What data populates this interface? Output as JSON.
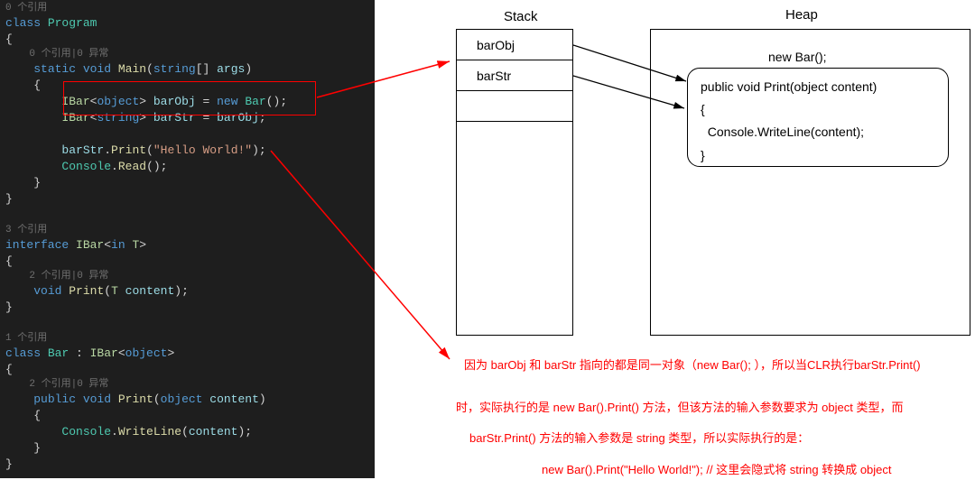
{
  "code": {
    "ref0": "0 个引用",
    "classProgram_class": "class ",
    "classProgram_name": "Program",
    "brace_open": "{",
    "brace_close": "}",
    "ref1": "0 个引用|0 异常",
    "mainSig_pre": "static void ",
    "mainSig_name": "Main",
    "mainSig_paren_open": "(",
    "mainSig_param_type": "string",
    "mainSig_param_brackets": "[] ",
    "mainSig_param_name": "args",
    "mainSig_paren_close": ")",
    "l1_iface": "IBar",
    "l1_lt": "<",
    "l1_typearg": "object",
    "l1_gt": "> ",
    "l1_var": "barObj",
    "l1_eq": " = ",
    "l1_new": "new ",
    "l1_ctor": "Bar",
    "l1_parens": "();",
    "l2_iface": "IBar",
    "l2_lt": "<",
    "l2_typearg": "string",
    "l2_gt": "> ",
    "l2_var": "barStr",
    "l2_eq": " = ",
    "l2_rhs": "barObj",
    "l2_semi": ";",
    "l3_var": "barStr",
    "l3_dot": ".",
    "l3_method": "Print",
    "l3_paren_open": "(",
    "l3_string": "\"Hello World!\"",
    "l3_paren_close": ");",
    "l4_class": "Console",
    "l4_dot": ".",
    "l4_method": "Read",
    "l4_parens": "();",
    "ref3": "3 个引用",
    "ifaceDecl_kw": "interface ",
    "ifaceDecl_name": "IBar",
    "ifaceDecl_lt": "<",
    "ifaceDecl_in": "in ",
    "ifaceDecl_T": "T",
    "ifaceDecl_gt": ">",
    "ref2": "2 个引用|0 异常",
    "ifaceMethod_void": "void ",
    "ifaceMethod_name": "Print",
    "ifaceMethod_paren_open": "(",
    "ifaceMethod_T": "T ",
    "ifaceMethod_param": "content",
    "ifaceMethod_paren_close": ");",
    "ref1b": "1 个引用",
    "barDecl_class": "class ",
    "barDecl_name": "Bar",
    "barDecl_colon": " : ",
    "barDecl_iface": "IBar",
    "barDecl_lt": "<",
    "barDecl_typearg": "object",
    "barDecl_gt": ">",
    "ref2b": "2 个引用|0 异常",
    "printDecl_public": "public void ",
    "printDecl_name": "Print",
    "printDecl_paren_open": "(",
    "printDecl_ptype": "object ",
    "printDecl_pname": "content",
    "printDecl_paren_close": ")",
    "body_class": "Console",
    "body_dot": ".",
    "body_method": "WriteLine",
    "body_paren_open": "(",
    "body_arg": "content",
    "body_paren_close": ");"
  },
  "diagram": {
    "stackTitle": "Stack",
    "heapTitle": "Heap",
    "stackCell1": "barObj",
    "stackCell2": "barStr",
    "newBar": "new Bar();",
    "methodSig": "public void Print(object content)",
    "methodOpen": "{",
    "methodBody": "  Console.WriteLine(content);",
    "methodClose": "}"
  },
  "explain": {
    "e1": "因为 barObj 和 barStr 指向的都是同一对象（new Bar(); ），所以当CLR执行barStr.Print()",
    "e2": "时，实际执行的是 new Bar().Print() 方法，但该方法的输入参数要求为 object 类型，而",
    "e3": "barStr.Print() 方法的输入参数是 string 类型，所以实际执行的是：",
    "e4": "new Bar().Print(\"Hello World!\");   // 这里会隐式将 string 转换成 object"
  }
}
